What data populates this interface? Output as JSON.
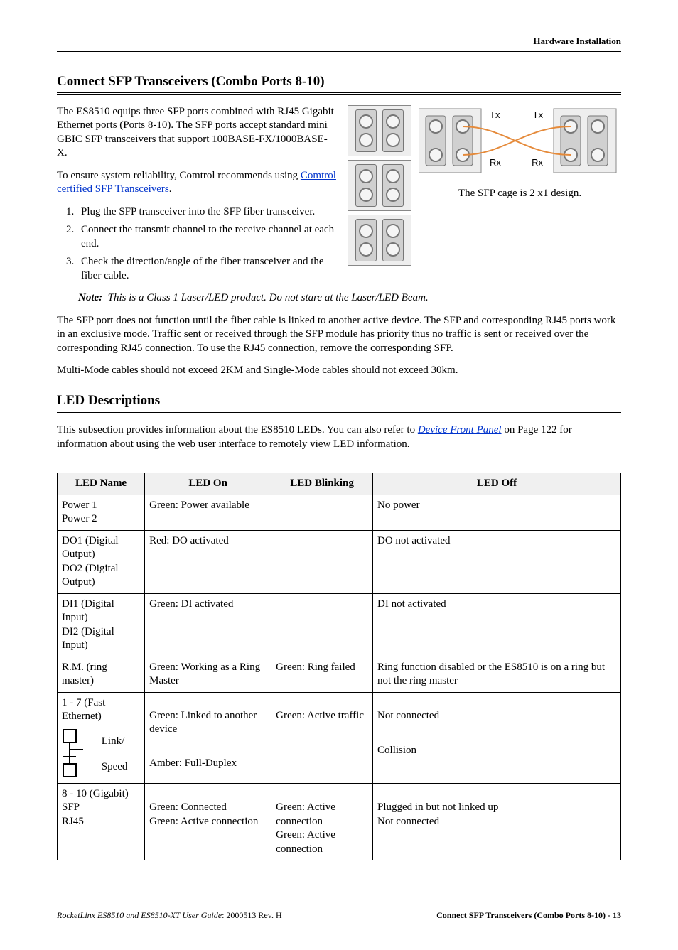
{
  "headerRight": "Hardware Installation",
  "section1": {
    "title": "Connect SFP Transceivers (Combo Ports 8-10)",
    "intro": "The ES8510 equips three SFP ports combined with RJ45 Gigabit Ethernet ports (Ports 8-10). The SFP ports accept standard mini GBIC SFP transceivers that support 100BASE-FX/1000BASE-X.",
    "reliabilityPrefix": "To ensure system reliability, Comtrol recommends using ",
    "reliabilityLink": "Comtrol certified SFP Transceivers",
    "reliabilitySuffix": ".",
    "steps": [
      "Plug the SFP transceiver into the SFP fiber transceiver.",
      "Connect the transmit channel to the receive channel at each end.",
      "Check the direction/angle of the fiber transceiver and the fiber cable."
    ],
    "noteLabel": "Note:",
    "noteText": "This is a Class 1 Laser/LED product. Do not stare at the Laser/LED Beam.",
    "para2": "The SFP port does not function until the fiber cable is linked to another active device. The SFP and corresponding RJ45 ports work in an exclusive mode. Traffic sent or received through the SFP module has priority thus no traffic is sent or received over the corresponding RJ45 connection. To use the RJ45 connection, remove the corresponding SFP.",
    "para3": "Multi-Mode cables should not exceed 2KM and Single-Mode cables should not exceed 30km.",
    "figCaption": "The SFP cage is 2 x1 design.",
    "figTx": "Tx",
    "figRx": "Rx"
  },
  "section2": {
    "title": "LED Descriptions",
    "introPrefix": "This subsection provides information about the ES8510 LEDs. You can also refer to ",
    "introLink": "Device Front Panel",
    "introSuffix": " on Page 122 for information about using the web user interface to remotely view LED information."
  },
  "table": {
    "headers": [
      "LED Name",
      "LED On",
      "LED Blinking",
      "LED Off"
    ],
    "rows": [
      {
        "name": "Power 1\nPower 2",
        "on": "Green: Power available",
        "blinking": "",
        "off": "No power"
      },
      {
        "name": "DO1 (Digital Output)\nDO2 (Digital Output)",
        "on": "Red: DO activated",
        "blinking": "",
        "off": "DO not activated"
      },
      {
        "name": "DI1 (Digital Input)\nDI2 (Digital Input)",
        "on": "Green: DI activated",
        "blinking": "",
        "off": "DI not activated"
      },
      {
        "name": "R.M. (ring master)",
        "on": "Green: Working as a Ring Master",
        "blinking": "Green: Ring failed",
        "off": "Ring function disabled or the ES8510 is on a ring but not the ring master"
      }
    ],
    "fastEth": {
      "title": "1 - 7 (Fast Ethernet)",
      "linkLabel": "Link/",
      "speedLabel": "Speed",
      "onLink": "Green: Linked to another device",
      "onSpeed": "Amber: Full-Duplex",
      "blinkingLink": "Green: Active traffic",
      "offLink": "Not connected",
      "offSpeed": "Collision"
    },
    "gigabit": {
      "title": "8 - 10 (Gigabit)",
      "sfp": "SFP",
      "rj45": "RJ45",
      "onSfp": "Green: Connected",
      "onRj": "Green: Active connection",
      "blinkSfp": "Green: Active connection",
      "blinkRj": "Green: Active connection",
      "offSfp": "Plugged in but not linked up",
      "offRj": "Not connected"
    }
  },
  "footer": {
    "leftItalic": "RocketLinx ES8510  and ES8510-XT User Guide",
    "leftPlain": ": 2000513 Rev. H",
    "right": "Connect SFP Transceivers (Combo Ports 8-10) - 13"
  }
}
